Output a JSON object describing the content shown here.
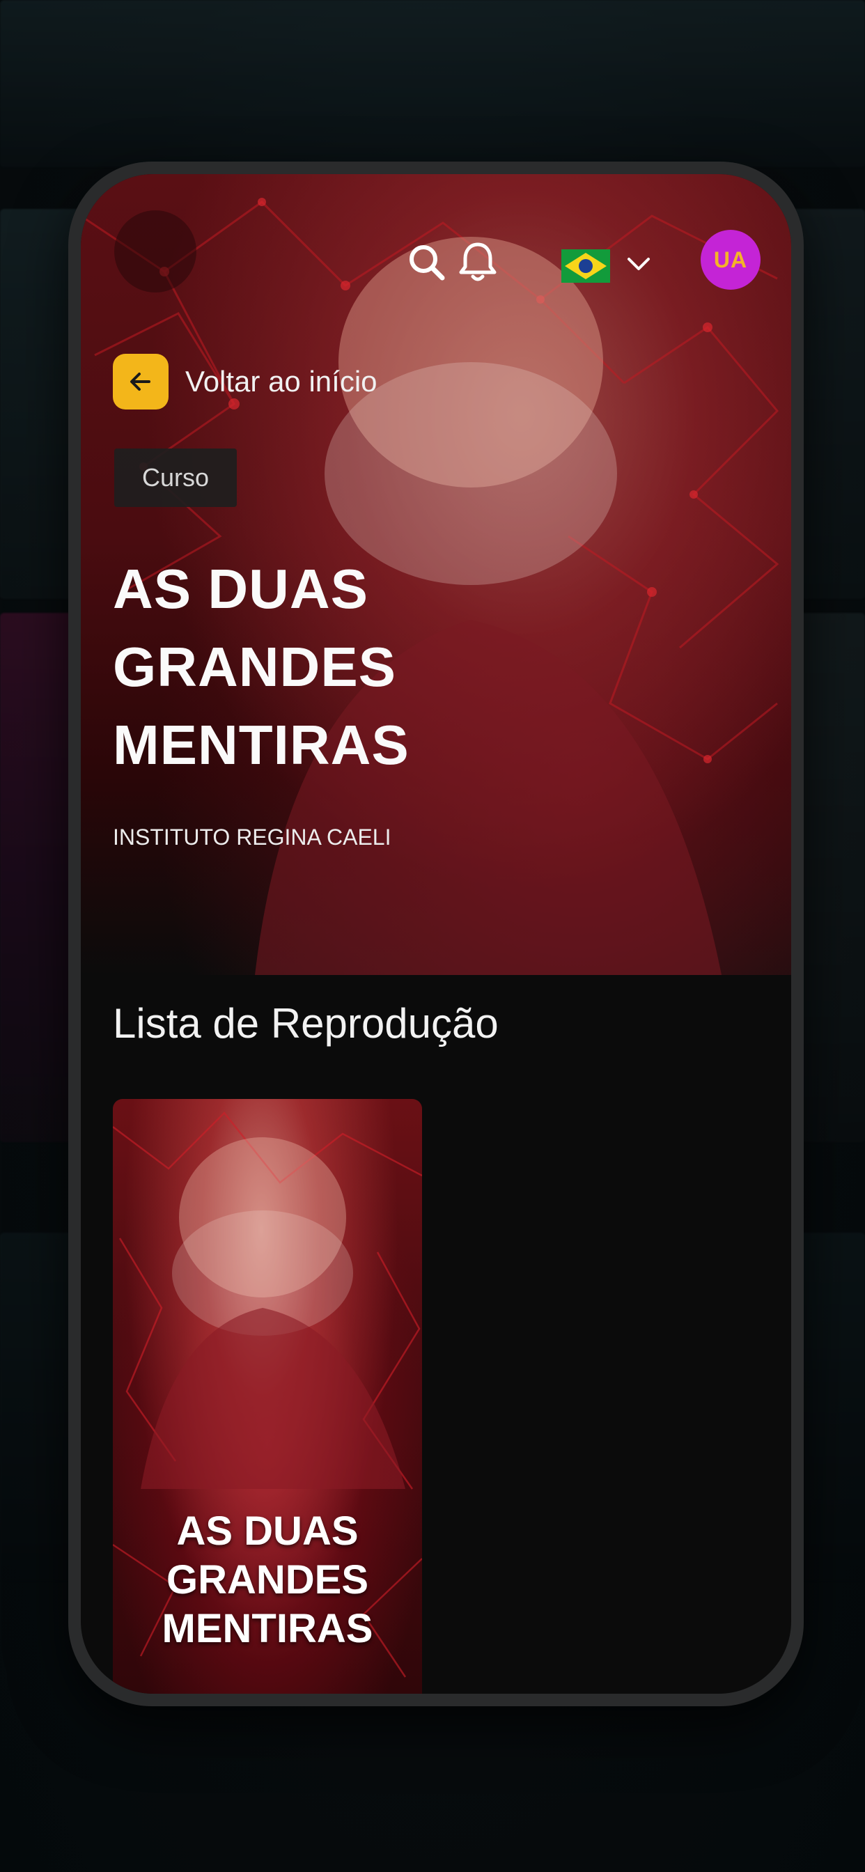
{
  "header": {
    "user_initials": "UA",
    "language_flag": "brazil-flag"
  },
  "navigation": {
    "back_label": "Voltar ao início"
  },
  "course": {
    "tag": "Curso",
    "title_lines": [
      "AS DUAS",
      "GRANDES",
      "MENTIRAS"
    ],
    "author": "INSTITUTO REGINA CAELI"
  },
  "playlist": {
    "section_title": "Lista de Reprodução",
    "items": [
      {
        "title_lines": [
          "AS DUAS",
          "GRANDES",
          "MENTIRAS"
        ]
      }
    ]
  },
  "colors": {
    "accent_yellow": "#f3b61a",
    "avatar_bg": "#c424d6",
    "avatar_text": "#f4b428",
    "background": "#0b0b0b"
  }
}
